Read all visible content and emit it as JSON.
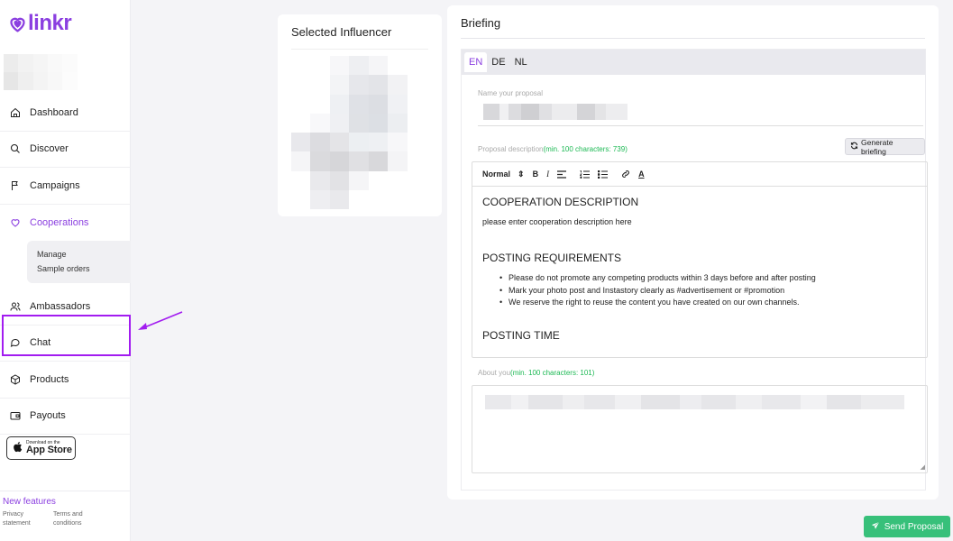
{
  "brand": {
    "name": "linkr",
    "accent": "#8b3fe0"
  },
  "sidebar": {
    "items": [
      {
        "label": "Dashboard",
        "icon": "home-icon"
      },
      {
        "label": "Discover",
        "icon": "search-icon"
      },
      {
        "label": "Campaigns",
        "icon": "flag-icon"
      },
      {
        "label": "Cooperations",
        "icon": "heart-icon"
      },
      {
        "label": "Ambassadors",
        "icon": "users-icon"
      },
      {
        "label": "Chat",
        "icon": "chat-icon"
      },
      {
        "label": "Products",
        "icon": "box-icon"
      },
      {
        "label": "Payouts",
        "icon": "wallet-icon"
      }
    ],
    "subitems": [
      "Manage",
      "Sample orders"
    ],
    "appstore": {
      "small": "Download on the",
      "big": "App Store"
    },
    "new_features": "New features",
    "footer": {
      "privacy": "Privacy statement",
      "terms": "Terms and conditions"
    }
  },
  "influencer": {
    "title": "Selected Influencer"
  },
  "briefing": {
    "title": "Briefing",
    "tabs": [
      "EN",
      "DE",
      "NL"
    ],
    "name_label": "Name your proposal",
    "desc_label": "Proposal description",
    "desc_count": "(min. 100 characters: 739)",
    "generate_label": "Generate briefing",
    "toolbar": {
      "format": "Normal",
      "bold": "B",
      "italic": "I",
      "color": "A"
    },
    "editor": {
      "heading1": "COOPERATION DESCRIPTION",
      "para1": "please enter cooperation description here",
      "heading2": "POSTING REQUIREMENTS",
      "bullets": [
        "Please do not promote any competing products within 3 days before and after posting",
        "Mark your photo post and Instastory clearly as #advertisement or #promotion",
        "We reserve the right to reuse the content you have created on our own channels."
      ],
      "heading3": "POSTING TIME"
    },
    "about_label": "About you",
    "about_count": "(min. 100 characters: 101)"
  },
  "send_button": "Send Proposal"
}
